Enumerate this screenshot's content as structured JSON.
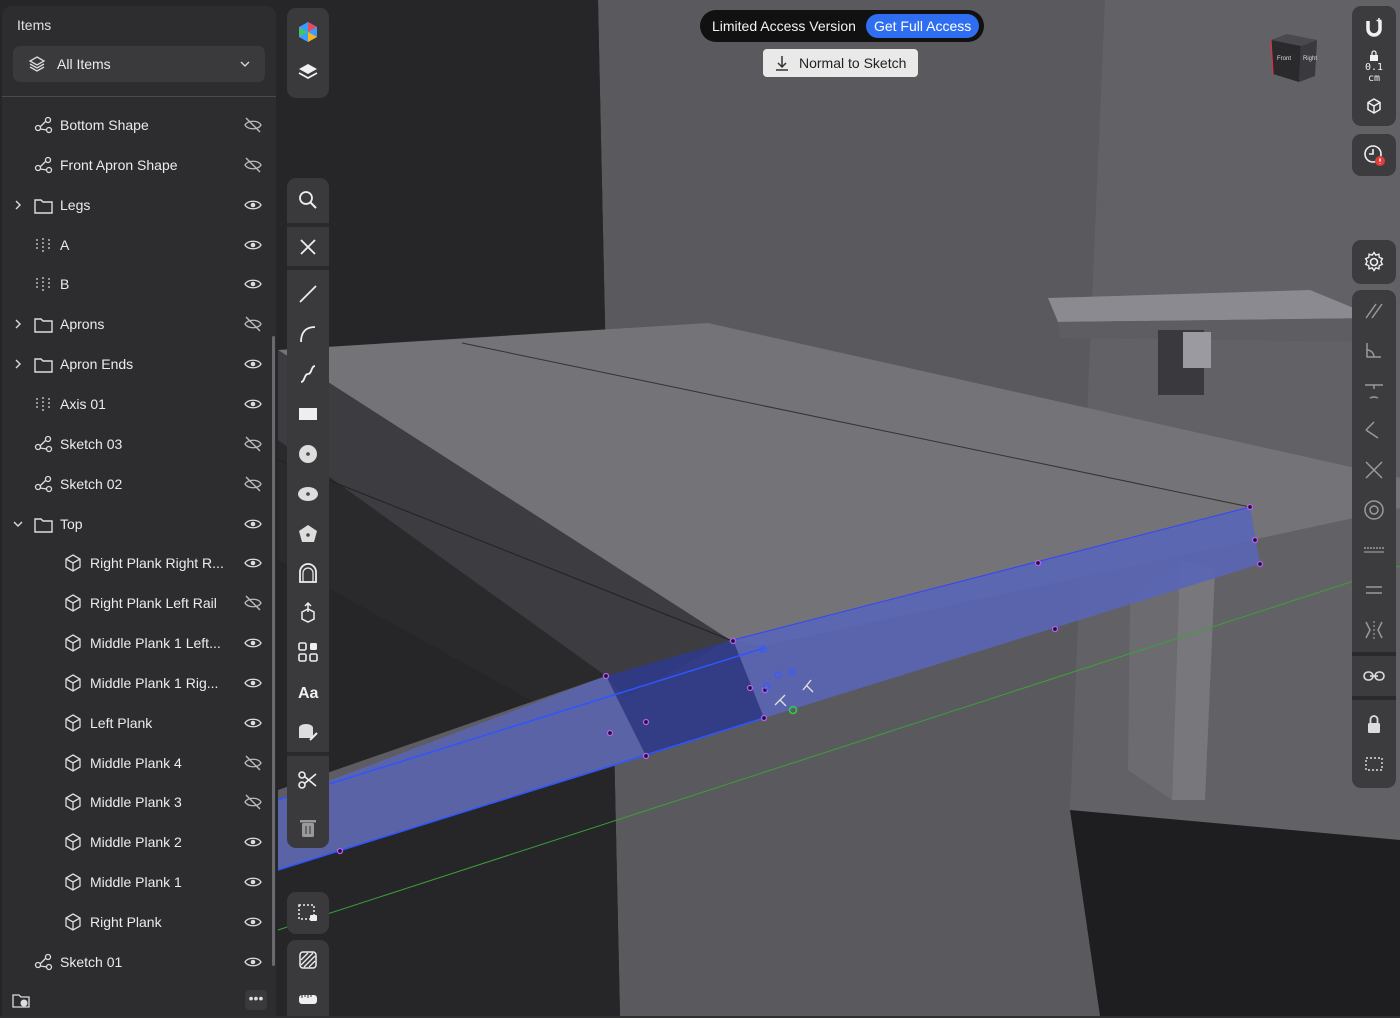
{
  "panel": {
    "title": "Items",
    "filter": "All Items",
    "items": [
      {
        "label": "Bottom Shape",
        "type": "sketch",
        "visible": false
      },
      {
        "label": "Front Apron Shape",
        "type": "sketch",
        "visible": false
      },
      {
        "label": "Legs",
        "type": "folder",
        "visible": true,
        "expander": "collapsed"
      },
      {
        "label": "A",
        "type": "axis",
        "visible": true
      },
      {
        "label": "B",
        "type": "axis",
        "visible": true
      },
      {
        "label": "Aprons",
        "type": "folder",
        "visible": false,
        "expander": "collapsed"
      },
      {
        "label": "Apron Ends",
        "type": "folder",
        "visible": true,
        "expander": "collapsed"
      },
      {
        "label": "Axis 01",
        "type": "axis",
        "visible": true
      },
      {
        "label": "Sketch 03",
        "type": "sketch",
        "visible": false
      },
      {
        "label": "Sketch 02",
        "type": "sketch",
        "visible": false
      },
      {
        "label": "Top",
        "type": "folder",
        "visible": true,
        "expander": "expanded"
      },
      {
        "label": "Right Plank Right R...",
        "type": "body",
        "visible": true,
        "child": true
      },
      {
        "label": "Right Plank Left Rail",
        "type": "body",
        "visible": false,
        "child": true
      },
      {
        "label": "Middle Plank 1 Left...",
        "type": "body",
        "visible": true,
        "child": true
      },
      {
        "label": "Middle Plank 1 Rig...",
        "type": "body",
        "visible": true,
        "child": true
      },
      {
        "label": "Left Plank",
        "type": "body",
        "visible": true,
        "child": true
      },
      {
        "label": "Middle Plank 4",
        "type": "body",
        "visible": false,
        "child": true
      },
      {
        "label": "Middle Plank 3",
        "type": "body",
        "visible": false,
        "child": true
      },
      {
        "label": "Middle Plank 2",
        "type": "body",
        "visible": true,
        "child": true
      },
      {
        "label": "Middle Plank 1",
        "type": "body",
        "visible": true,
        "child": true
      },
      {
        "label": "Right Plank",
        "type": "body",
        "visible": true,
        "child": true
      },
      {
        "label": "Sketch 01",
        "type": "sketch",
        "visible": true
      }
    ]
  },
  "banner": {
    "limited": "Limited Access Version",
    "get_full": "Get Full Access"
  },
  "normal_to_sketch": "Normal to Sketch",
  "view_cube": {
    "front": "Front",
    "right": "Right"
  },
  "units": {
    "value": "0.1",
    "unit": "cm"
  },
  "toolbar_icons": [
    "color-palette",
    "layers",
    "search",
    "close",
    "line",
    "arc",
    "spline",
    "rectangle",
    "circle",
    "ellipse",
    "polygon",
    "offset",
    "transform",
    "pattern",
    "text",
    "stamp",
    "trim",
    "delete",
    "select-lock",
    "hatch",
    "measure"
  ],
  "colors": {
    "selection": "#5965b8",
    "edge": "#2e55ff",
    "vertex": "#b85cff",
    "accent": "#2f6ef0"
  }
}
